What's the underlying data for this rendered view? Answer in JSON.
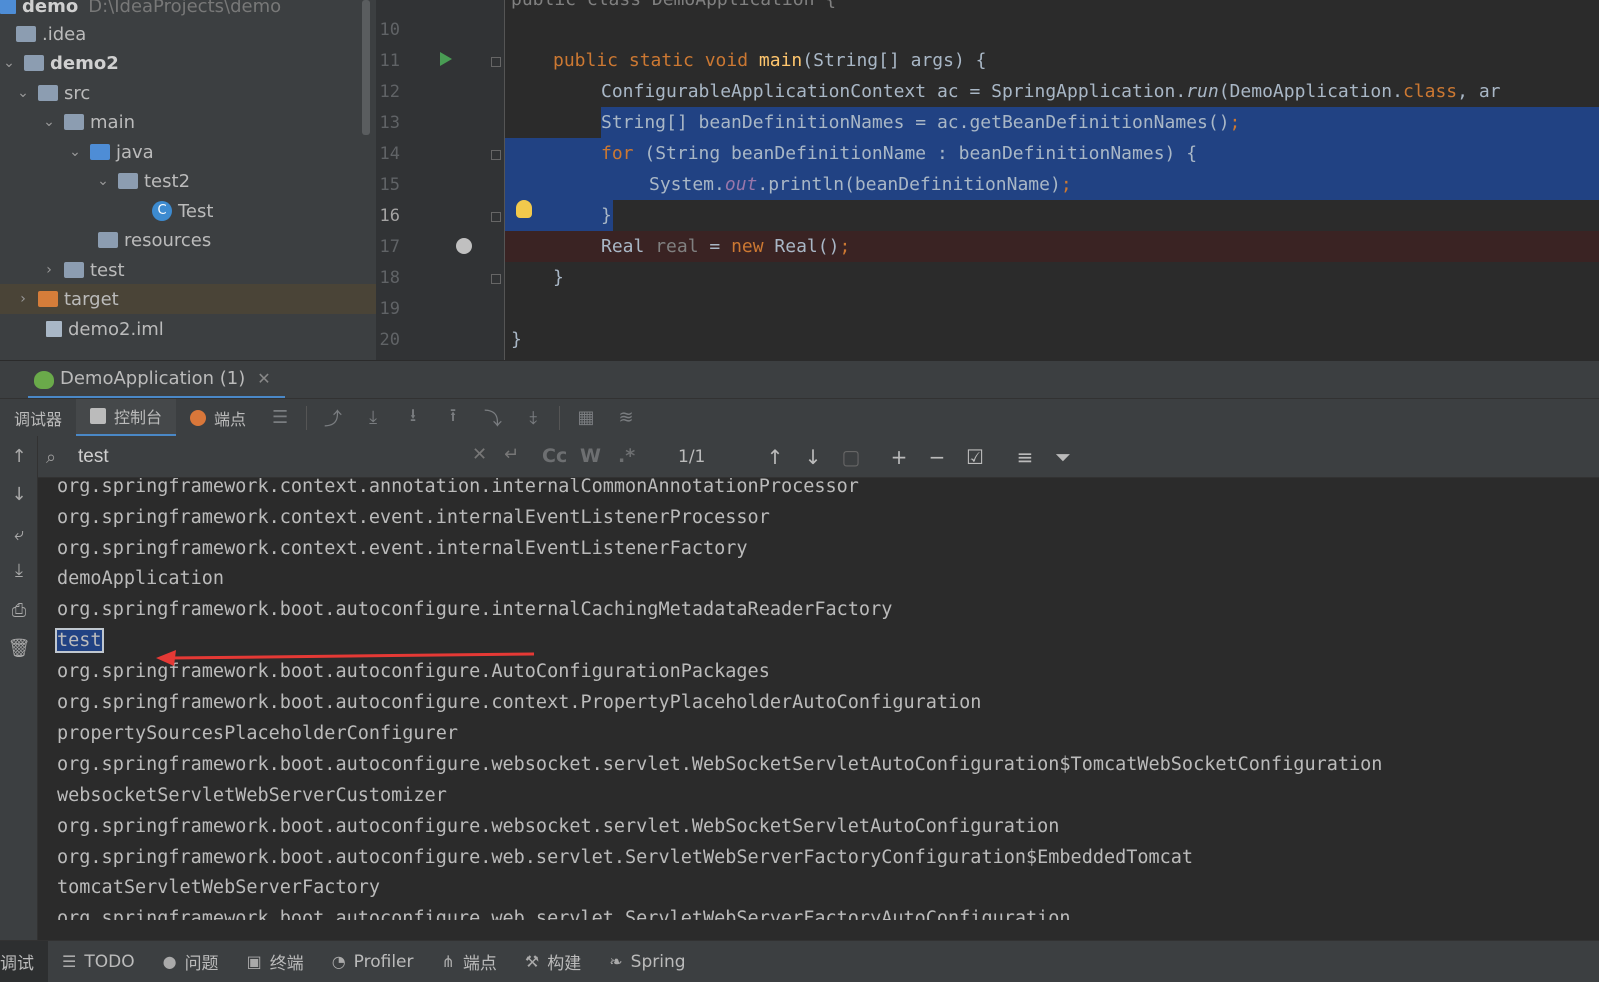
{
  "project": {
    "root_name": "demo",
    "root_path": "D:\\IdeaProjects\\demo",
    "items": [
      {
        "label": ".idea",
        "kind": "folder"
      },
      {
        "label": "demo2",
        "kind": "module"
      },
      {
        "label": "src",
        "kind": "folder"
      },
      {
        "label": "main",
        "kind": "folder"
      },
      {
        "label": "java",
        "kind": "source-folder"
      },
      {
        "label": "test2",
        "kind": "package"
      },
      {
        "label": "Test",
        "kind": "class"
      },
      {
        "label": "resources",
        "kind": "resources-folder"
      },
      {
        "label": "test",
        "kind": "folder"
      },
      {
        "label": "target",
        "kind": "excluded-folder"
      },
      {
        "label": "demo2.iml",
        "kind": "file"
      }
    ]
  },
  "editor": {
    "line_numbers": [
      "10",
      "11",
      "12",
      "13",
      "14",
      "15",
      "16",
      "17",
      "18",
      "19",
      "20"
    ],
    "header_fragment": "public class DemoApplication {",
    "current_line": "16",
    "lines": {
      "l11": {
        "kw1": "public static void ",
        "fn": "main",
        "rest": "(String[] args) {"
      },
      "l12": {
        "a": "ConfigurableApplicationContext ac = SpringApplication.",
        "run": "run",
        "b": "(DemoApplication.",
        "cls": "class",
        "c": ", ar"
      },
      "l13": {
        "a": "String[] beanDefinitionNames = ac.getBeanDefinitionNames()",
        "semi": ";"
      },
      "l14": {
        "kw": "for",
        "a": " (String beanDefinitionName : beanDefinitionNames) {"
      },
      "l15": {
        "a": "System.",
        "out": "out",
        "b": ".println(beanDefinitionName)",
        "semi": ";"
      },
      "l16": {
        "a": "}"
      },
      "l17": {
        "a": "Real ",
        "var": "real",
        "b": " = ",
        "kw": "new",
        "c": " Real()",
        "semi": ";"
      },
      "l18": {
        "a": "}"
      },
      "l20": {
        "a": "}"
      }
    }
  },
  "run": {
    "tab_title": "DemoApplication (1)",
    "subtabs": [
      {
        "label": "调试器"
      },
      {
        "label": "控制台"
      },
      {
        "label": "端点"
      }
    ],
    "find": {
      "query": "test",
      "count": "1/1",
      "opt_case": "Cc",
      "opt_word": "W",
      "opt_regex": ".*"
    },
    "console_lines": [
      "org.springframework.context.annotation.internalCommonAnnotationProcessor",
      "org.springframework.context.event.internalEventListenerProcessor",
      "org.springframework.context.event.internalEventListenerFactory",
      "demoApplication",
      "org.springframework.boot.autoconfigure.internalCachingMetadataReaderFactory",
      "test",
      "org.springframework.boot.autoconfigure.AutoConfigurationPackages",
      "org.springframework.boot.autoconfigure.context.PropertyPlaceholderAutoConfiguration",
      "propertySourcesPlaceholderConfigurer",
      "org.springframework.boot.autoconfigure.websocket.servlet.WebSocketServletAutoConfiguration$TomcatWebSocketConfiguration",
      "websocketServletWebServerCustomizer",
      "org.springframework.boot.autoconfigure.websocket.servlet.WebSocketServletAutoConfiguration",
      "org.springframework.boot.autoconfigure.web.servlet.ServletWebServerFactoryConfiguration$EmbeddedTomcat",
      "tomcatServletWebServerFactory",
      "org.springframework.boot.autoconfigure.web.servlet.ServletWebServerFactoryAutoConfiguration"
    ],
    "highlight_color": "#214283",
    "arrow_color": "#e53935"
  },
  "statusbar": {
    "items": [
      {
        "label": "调试",
        "icon": "debug-icon"
      },
      {
        "label": "TODO",
        "icon": "list-icon"
      },
      {
        "label": "问题",
        "icon": "problems-icon"
      },
      {
        "label": "终端",
        "icon": "terminal-icon"
      },
      {
        "label": "Profiler",
        "icon": "profiler-icon"
      },
      {
        "label": "端点",
        "icon": "endpoints-icon"
      },
      {
        "label": "构建",
        "icon": "build-icon"
      },
      {
        "label": "Spring",
        "icon": "spring-icon"
      }
    ]
  }
}
